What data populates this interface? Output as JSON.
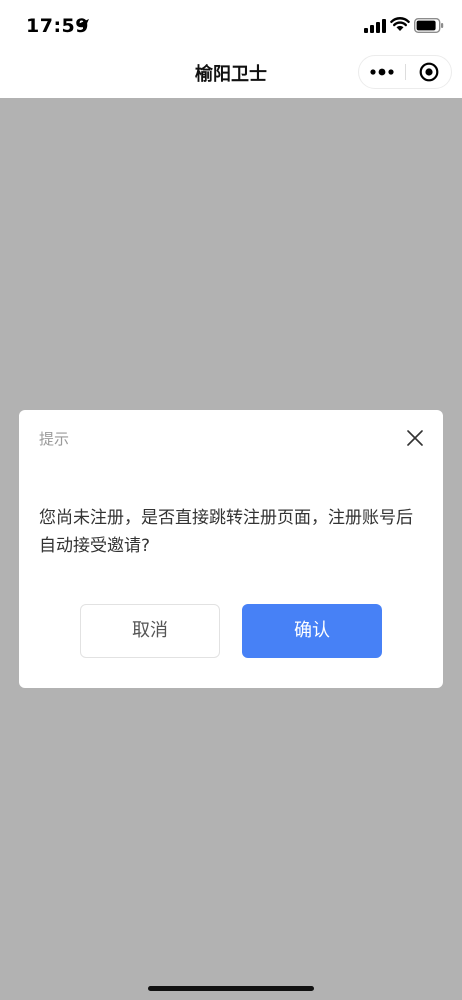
{
  "status_bar": {
    "time": "17:59",
    "icons": [
      "location-arrow-icon",
      "signal-icon",
      "wifi-icon",
      "battery-icon"
    ]
  },
  "nav_bar": {
    "title": "榆阳卫士",
    "capsule": {
      "more_icon": "more-dots-icon",
      "close_icon": "target-circle-icon"
    }
  },
  "dialog": {
    "title": "提示",
    "close_icon": "close-x-icon",
    "message": "您尚未注册，是否直接跳转注册页面，注册账号后自动接受邀请?",
    "cancel_label": "取消",
    "confirm_label": "确认"
  },
  "colors": {
    "overlay": "#b2b2b2",
    "nav_background": "#ffffff",
    "dialog_background": "#ffffff",
    "confirm_button": "#4781f6",
    "title_text": "#9a9a9a",
    "message_text": "#333333"
  }
}
